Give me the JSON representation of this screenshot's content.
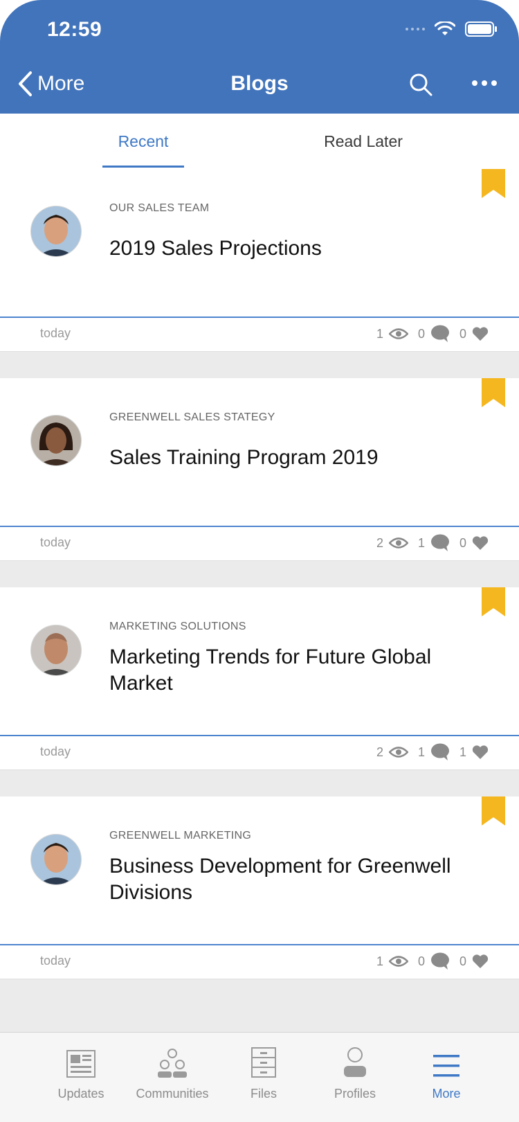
{
  "status": {
    "time": "12:59"
  },
  "nav": {
    "back_label": "More",
    "title": "Blogs"
  },
  "tabs": [
    {
      "label": "Recent",
      "active": true
    },
    {
      "label": "Read Later",
      "active": false
    }
  ],
  "posts": [
    {
      "category": "OUR SALES TEAM",
      "title": "2019 Sales Projections",
      "date": "today",
      "views": "1",
      "comments": "0",
      "likes": "0"
    },
    {
      "category": "GREENWELL SALES STATEGY",
      "title": "Sales Training Program 2019",
      "date": "today",
      "views": "2",
      "comments": "1",
      "likes": "0"
    },
    {
      "category": "MARKETING SOLUTIONS",
      "title": "Marketing Trends for Future Global Market",
      "date": "today",
      "views": "2",
      "comments": "1",
      "likes": "1"
    },
    {
      "category": "GREENWELL MARKETING",
      "title": "Business Development for Greenwell Divisions",
      "date": "today",
      "views": "1",
      "comments": "0",
      "likes": "0"
    }
  ],
  "tabbar": [
    {
      "label": "Updates",
      "icon": "newspaper-icon"
    },
    {
      "label": "Communities",
      "icon": "people-icon"
    },
    {
      "label": "Files",
      "icon": "file-cabinet-icon"
    },
    {
      "label": "Profiles",
      "icon": "person-icon"
    },
    {
      "label": "More",
      "icon": "menu-icon",
      "active": true
    }
  ],
  "colors": {
    "header": "#4274bb",
    "accent": "#3f79c6",
    "bookmark": "#f5b720"
  }
}
